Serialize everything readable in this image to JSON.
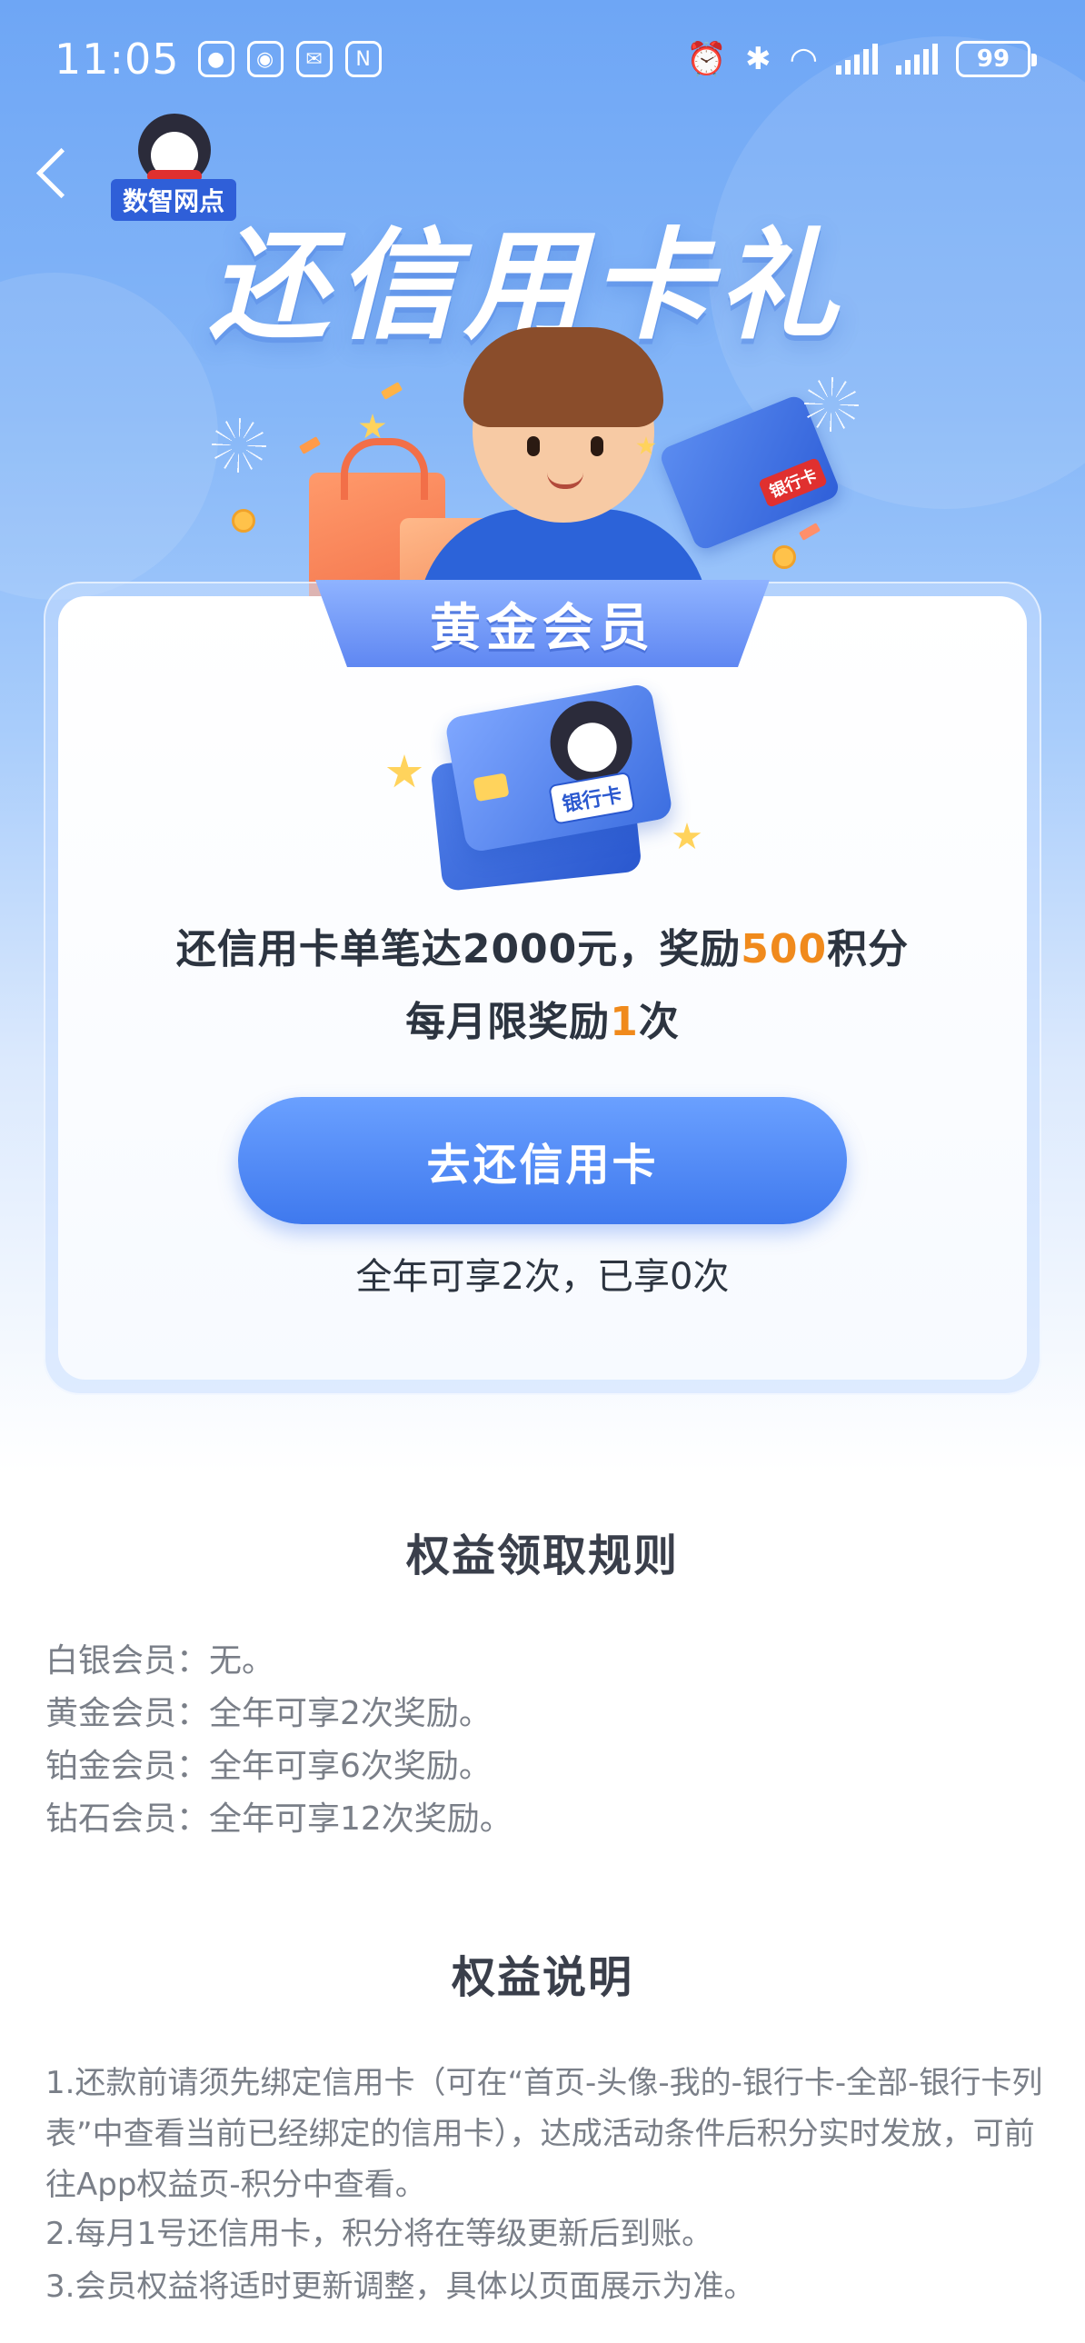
{
  "status_bar": {
    "time": "11:05",
    "battery": "99"
  },
  "header": {
    "logo_text": "数智网点",
    "title": "还信用卡礼"
  },
  "card": {
    "tier": "黄金会员",
    "bank_card_tag": "银行卡",
    "reward": {
      "prefix": "还信用卡单笔达2000元，奖励",
      "points": "500",
      "suffix": "积分"
    },
    "limit": {
      "prefix": "每月限奖励",
      "count": "1",
      "suffix": "次"
    },
    "cta_label": "去还信用卡",
    "usage": "全年可享2次，已享0次"
  },
  "rules": {
    "title": "权益领取规则",
    "items": [
      "白银会员：无。",
      "黄金会员：全年可享2次奖励。",
      "铂金会员：全年可享6次奖励。",
      "钻石会员：全年可享12次奖励。"
    ]
  },
  "notes": {
    "title": "权益说明",
    "items": [
      "1.还款前请须先绑定信用卡（可在“首页-头像-我的-银行卡-全部-银行卡列表”中查看当前已经绑定的信用卡），达成活动条件后积分实时发放，可前往App权益页-积分中查看。",
      "2.每月1号还信用卡，积分将在等级更新后到账。",
      "3.会员权益将适时更新调整，具体以页面展示为准。"
    ]
  },
  "colors": {
    "accent": "#f08a1c",
    "primary": "#3f79ee",
    "hero_top": "#6ea6f5"
  }
}
